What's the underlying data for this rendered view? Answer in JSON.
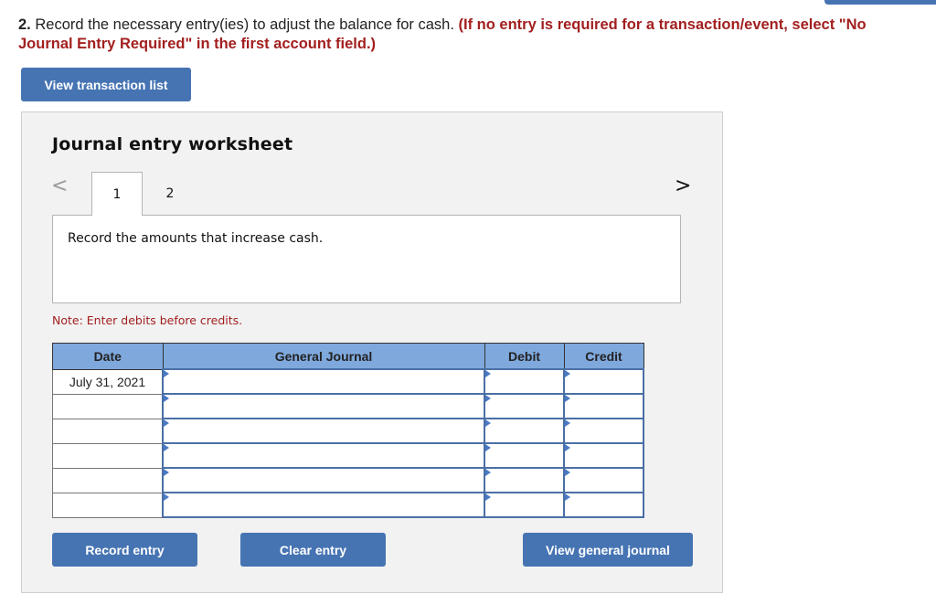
{
  "question": {
    "number": "2.",
    "text": " Record the necessary entry(ies) to adjust the balance for cash. ",
    "instruction_line1": "(If no entry is required for a transaction/event, select \"No",
    "instruction_line2": "Journal Entry Required\" in the first account field.)"
  },
  "buttons": {
    "view_transaction_list": "View transaction list",
    "record_entry": "Record entry",
    "clear_entry": "Clear entry",
    "view_general_journal": "View general journal"
  },
  "worksheet": {
    "title": "Journal entry worksheet",
    "nav_prev": "<",
    "nav_next": ">",
    "tabs": [
      {
        "label": "1",
        "active": true
      },
      {
        "label": "2",
        "active": false
      }
    ],
    "description": "Record the amounts that increase cash.",
    "note": "Note: Enter debits before credits."
  },
  "table": {
    "headers": {
      "date": "Date",
      "general_journal": "General Journal",
      "debit": "Debit",
      "credit": "Credit"
    },
    "rows": [
      {
        "date": "July 31, 2021",
        "account": "",
        "debit": "",
        "credit": ""
      },
      {
        "date": "",
        "account": "",
        "debit": "",
        "credit": ""
      },
      {
        "date": "",
        "account": "",
        "debit": "",
        "credit": ""
      },
      {
        "date": "",
        "account": "",
        "debit": "",
        "credit": ""
      },
      {
        "date": "",
        "account": "",
        "debit": "",
        "credit": ""
      },
      {
        "date": "",
        "account": "",
        "debit": "",
        "credit": ""
      }
    ]
  },
  "colors": {
    "button_blue": "#4674b3",
    "header_blue": "#7fa8dd",
    "instruction_red": "#a21f1f"
  }
}
